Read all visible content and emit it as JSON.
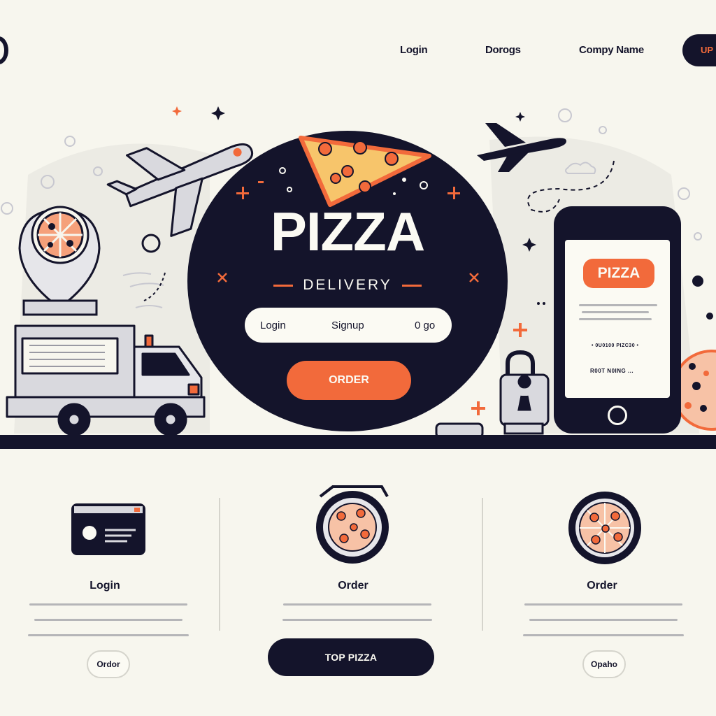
{
  "header": {
    "nav_links": [
      "Login",
      "Dorogs",
      "Compy Name"
    ],
    "cta_label": "UP"
  },
  "hero": {
    "title": "PIZZA",
    "subtitle": "DELIVERY",
    "auth": {
      "login": "Login",
      "signup": "Signup",
      "other": "0 go"
    },
    "order_button": "ORDER"
  },
  "phone": {
    "badge": "PIZZA",
    "line1": "• 0U0100 PIZC30 •",
    "line2": "R00T N0ING ..."
  },
  "features": [
    {
      "title": "Login",
      "icon": "credit-card-icon",
      "button": "Ordor"
    },
    {
      "title": "Order",
      "icon": "pizza-pan-icon",
      "button": "TOP PIZZA"
    },
    {
      "title": "Order",
      "icon": "pizza-icon",
      "button": "Opaho"
    }
  ],
  "colors": {
    "accent": "#f26a3b",
    "dark": "#14142b",
    "background": "#f7f6ee"
  }
}
